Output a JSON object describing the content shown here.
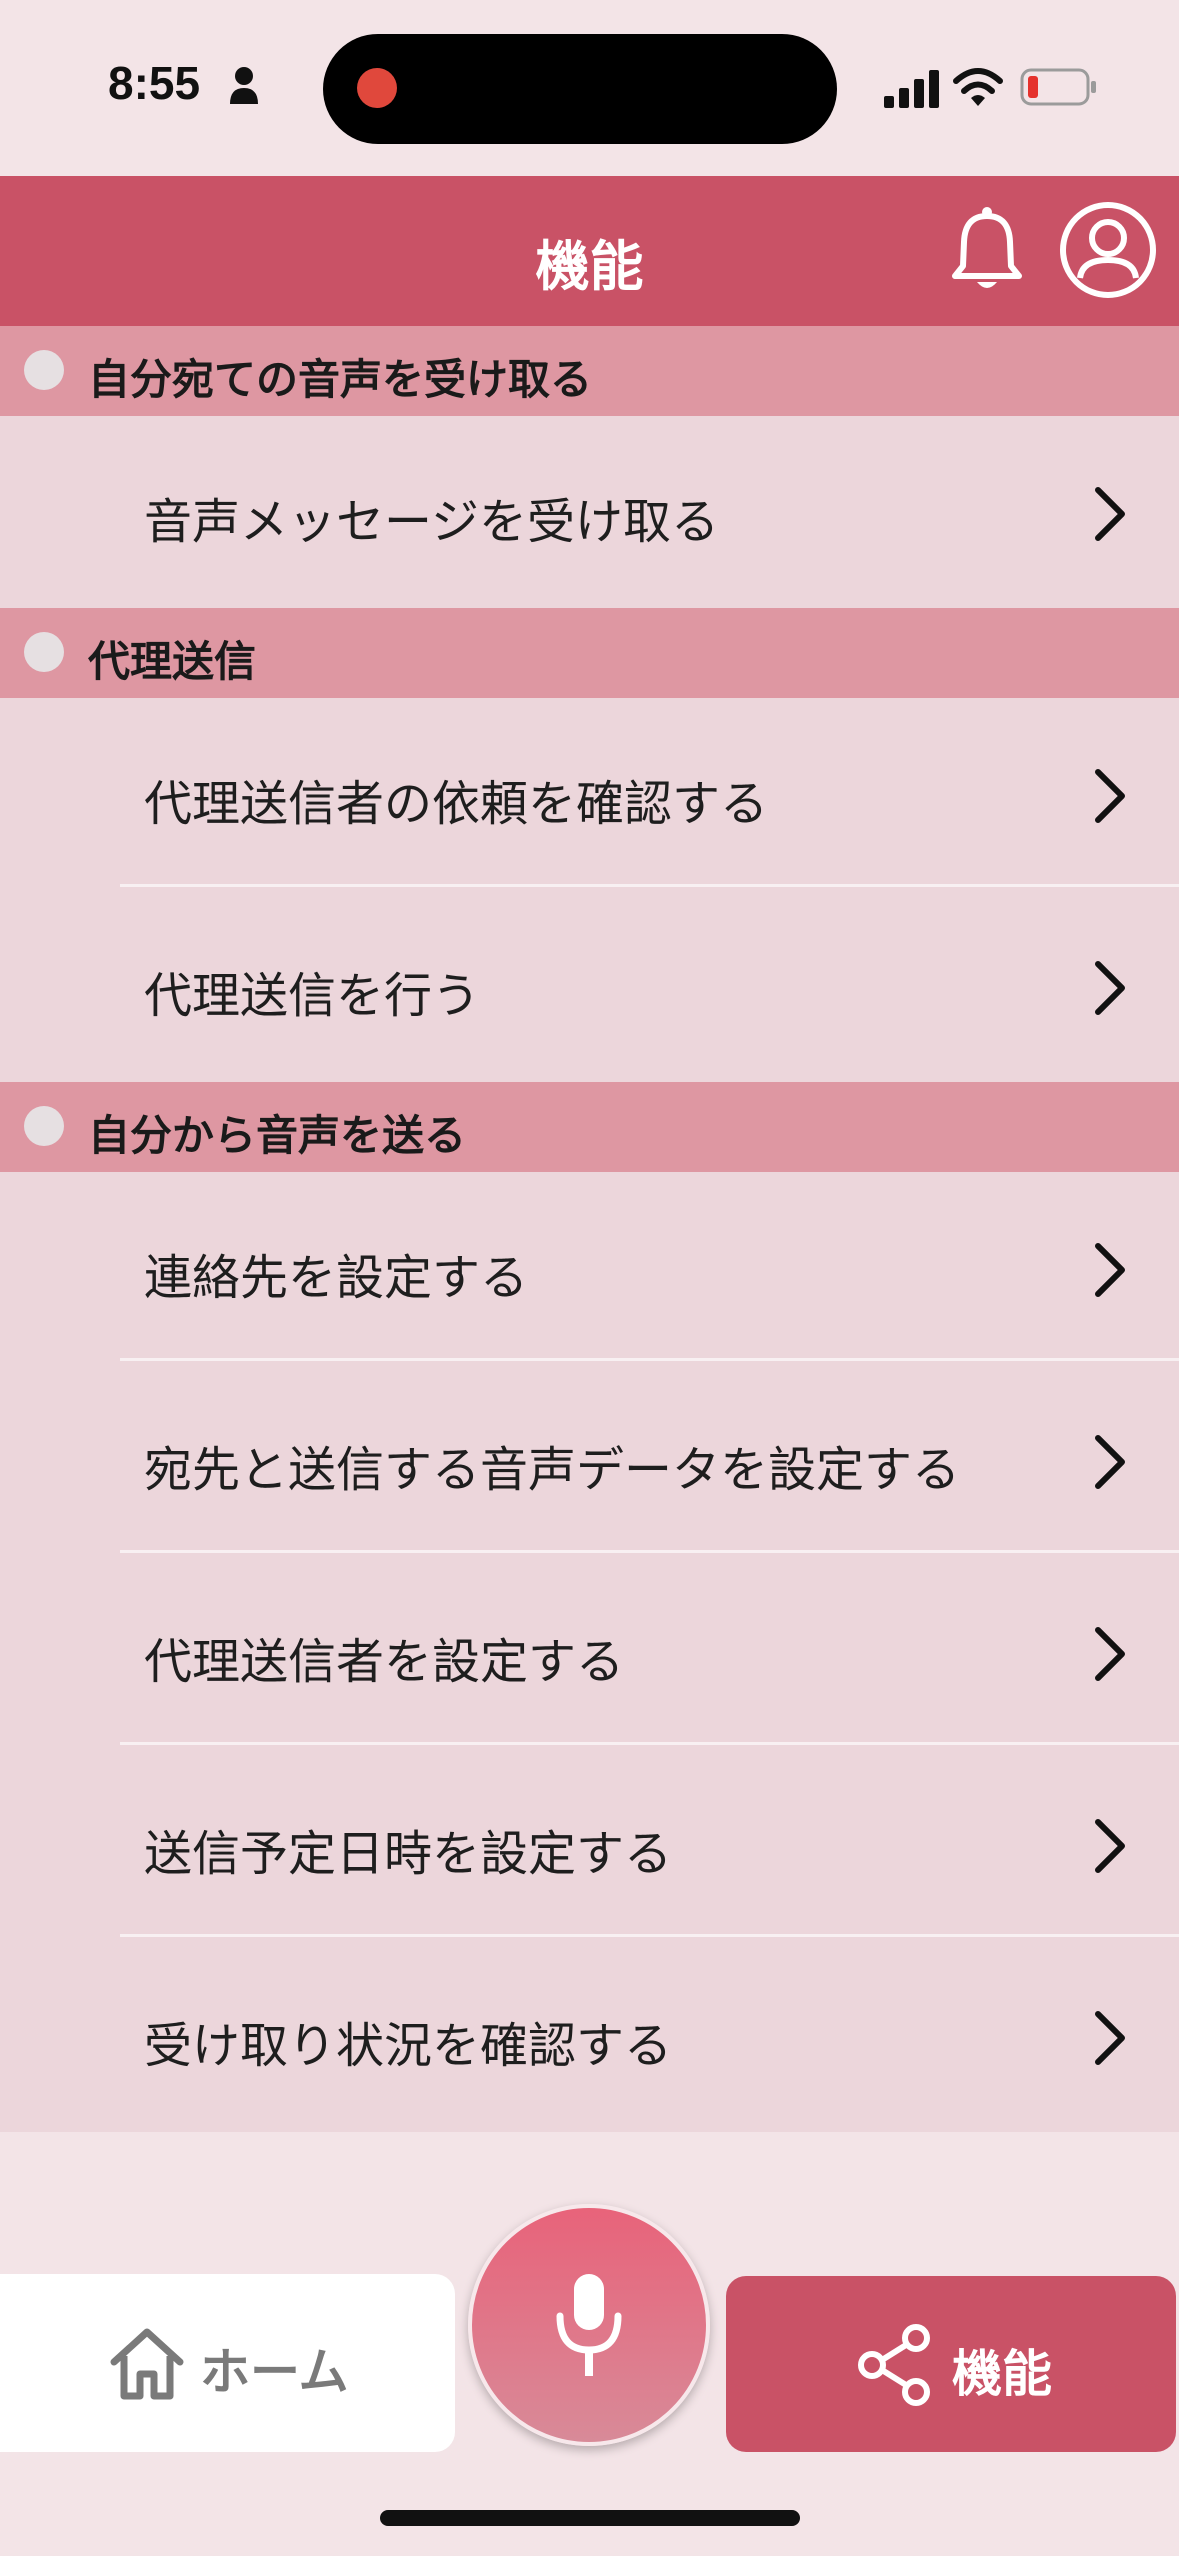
{
  "status_bar": {
    "time": "8:55"
  },
  "header": {
    "title": "機能"
  },
  "sections": [
    {
      "title": "自分宛ての音声を受け取る",
      "items": [
        "音声メッセージを受け取る"
      ]
    },
    {
      "title": "代理送信",
      "items": [
        "代理送信者の依頼を確認する",
        "代理送信を行う"
      ]
    },
    {
      "title": "自分から音声を送る",
      "items": [
        "連絡先を設定する",
        "宛先と送信する音声データを設定する",
        "代理送信者を設定する",
        "送信予定日時を設定する",
        "受け取り状況を確認する"
      ]
    }
  ],
  "bottom_nav": {
    "home_label": "ホーム",
    "features_label": "機能"
  },
  "colors": {
    "accent": "#c95266",
    "section_header": "#de97a2",
    "menu_background": "#ecd6db",
    "page_background": "#f3e4e7"
  },
  "icons": {
    "status": [
      "person-icon",
      "record-dot",
      "signal-icon",
      "wifi-icon",
      "battery-icon"
    ],
    "header": [
      "bell-icon",
      "account-icon"
    ],
    "menu": "chevron-right-icon",
    "nav": [
      "home-icon",
      "mic-icon",
      "share-icon"
    ]
  }
}
